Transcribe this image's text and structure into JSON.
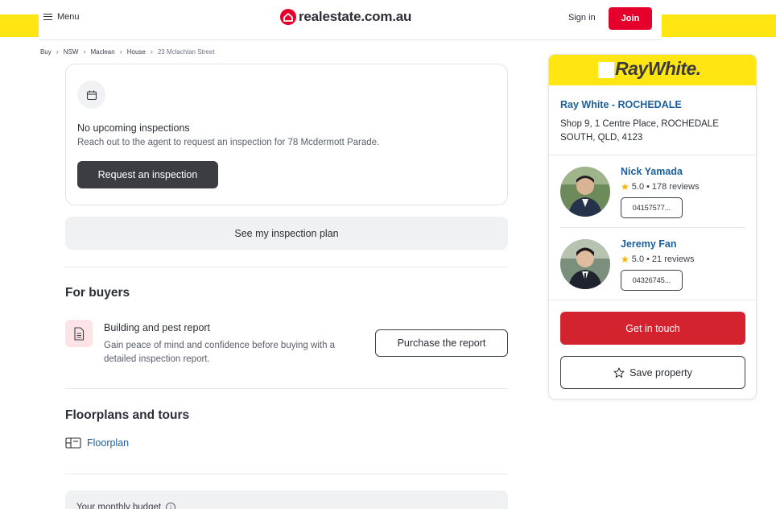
{
  "header": {
    "menu_label": "Menu",
    "logo_text": "realestate.com.au",
    "sign_in_label": "Sign in",
    "join_label": "Join",
    "brand_color": "#e4002b"
  },
  "breadcrumb": {
    "items": [
      "Buy",
      "NSW",
      "Maclean",
      "House",
      "23 Mclachlan Street"
    ]
  },
  "inspections": {
    "icon": "calendar-icon",
    "title": "No upcoming inspections",
    "subtitle": "Reach out to the agent to request an inspection for 78 Mcdermott Parade.",
    "request_button": "Request an inspection",
    "plan_button": "See my inspection plan"
  },
  "for_buyers": {
    "heading": "For buyers",
    "report_icon": "document-icon",
    "report_title": "Building and pest report",
    "report_description": "Gain peace of mind and confidence before buying with a detailed inspection report.",
    "purchase_button": "Purchase the report"
  },
  "floorplans": {
    "heading": "Floorplans and tours",
    "floorplan_icon": "floorplan-icon",
    "floorplan_link": "Floorplan"
  },
  "budget": {
    "label": "Your monthly budget"
  },
  "agent_panel": {
    "brand_logo": "RayWhite.",
    "brand_color": "#ffe512",
    "agency_name": "Ray White - ROCHEDALE",
    "agency_address": "Shop 9, 1 Centre Place, ROCHEDALE SOUTH, QLD, 4123",
    "agents": [
      {
        "name": "Nick Yamada",
        "rating": "5.0",
        "reviews": "178 reviews",
        "phone": "04157577..."
      },
      {
        "name": "Jeremy Fan",
        "rating": "5.0",
        "reviews": "21 reviews",
        "phone": "04326745..."
      }
    ],
    "get_in_touch": "Get in touch",
    "save_property": "Save property",
    "cta_color": "#d2232e"
  }
}
